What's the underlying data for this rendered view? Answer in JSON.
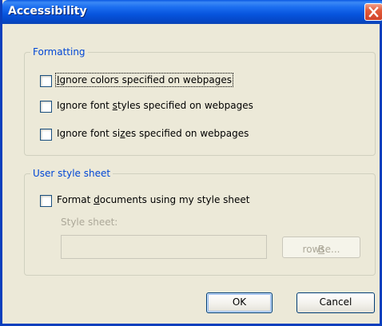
{
  "window": {
    "title": "Accessibility"
  },
  "formatting": {
    "legend": "Formatting",
    "options": [
      {
        "pre": "",
        "key": "I",
        "post": "gnore colors specified on webpages",
        "checked": false
      },
      {
        "pre": "Ignore font ",
        "key": "s",
        "post": "tyles specified on webpages",
        "checked": false
      },
      {
        "pre": "Ignore font si",
        "key": "z",
        "post": "es specified on webpages",
        "checked": false
      }
    ]
  },
  "user_style": {
    "legend": "User style sheet",
    "option": {
      "pre": "Format ",
      "key": "d",
      "post": "ocuments using my style sheet",
      "checked": false
    },
    "field_label": "Style sheet:",
    "field_value": "",
    "browse": {
      "key": "B",
      "post": "rowse..."
    }
  },
  "buttons": {
    "ok": "OK",
    "cancel": "Cancel"
  }
}
